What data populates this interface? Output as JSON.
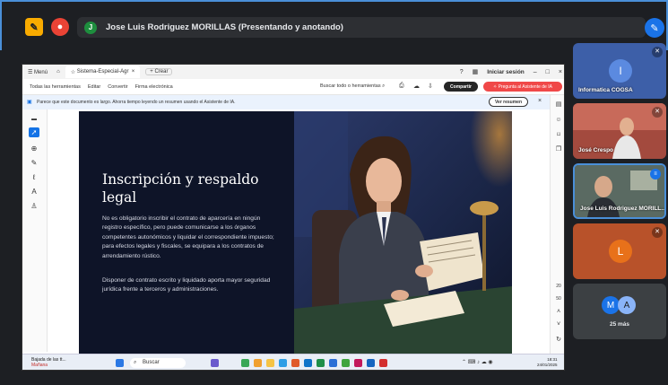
{
  "meeting": {
    "presenter_initial": "J",
    "presenter_status": "Jose Luis Rodriguez MORILLAS (Presentando y anotando)",
    "colors": {
      "accent": "#1a73e8",
      "presenter_avatar": "#1e8e3e",
      "stop_button": "#ea4335",
      "warning_button": "#f9ab00"
    }
  },
  "browser": {
    "menu_label": "Menú",
    "tab_title": "Sistema-Especial-Agr",
    "new_tab_label": "+ Crear",
    "signin_label": "Iniciar sesión"
  },
  "pdf_toolbar": {
    "items": [
      "Todas las herramientas",
      "Editar",
      "Convertir",
      "Firma electrónica"
    ],
    "search_label": "Buscar todo o herramientas",
    "share_label": "Compartir",
    "ai_assistant_label": "Pregunta al Asistente de IA"
  },
  "info_bar": {
    "text": "Parece que este documento es largo. Ahorra tiempo leyendo un resumen usando el Asistente de IA.",
    "button_label": "Ver resumen"
  },
  "slide": {
    "title": "Inscripción y respaldo legal",
    "paragraph1": "No es obligatorio inscribir el contrato de aparcería en ningún registro específico, pero puede comunicarse a los órganos competentes autonómicos y liquidar el correspondiente impuesto; para efectos legales y fiscales, se equipara a los contratos de arrendamiento rústico.",
    "paragraph2": "Disponer de contrato escrito y liquidado aporta mayor seguridad jurídica frente a terceros y administraciones."
  },
  "page_nav": {
    "current": "20",
    "total": "50"
  },
  "taskbar": {
    "weather_line1": "Bajada de las tt...",
    "weather_line2": "Mañana",
    "search_label": "Buscar",
    "time": "18:31",
    "date": "24/01/2025"
  },
  "participants": [
    {
      "name": "Informatica COGSA",
      "initial": "I",
      "color": "#5b8ae0"
    },
    {
      "name": "José Crespo"
    },
    {
      "name": "Jose Luis Rodriguez MORILL..."
    },
    {
      "initial": "L",
      "color": "#e8711a"
    },
    {
      "initials": [
        "M",
        "A"
      ],
      "label": "25 más"
    }
  ]
}
